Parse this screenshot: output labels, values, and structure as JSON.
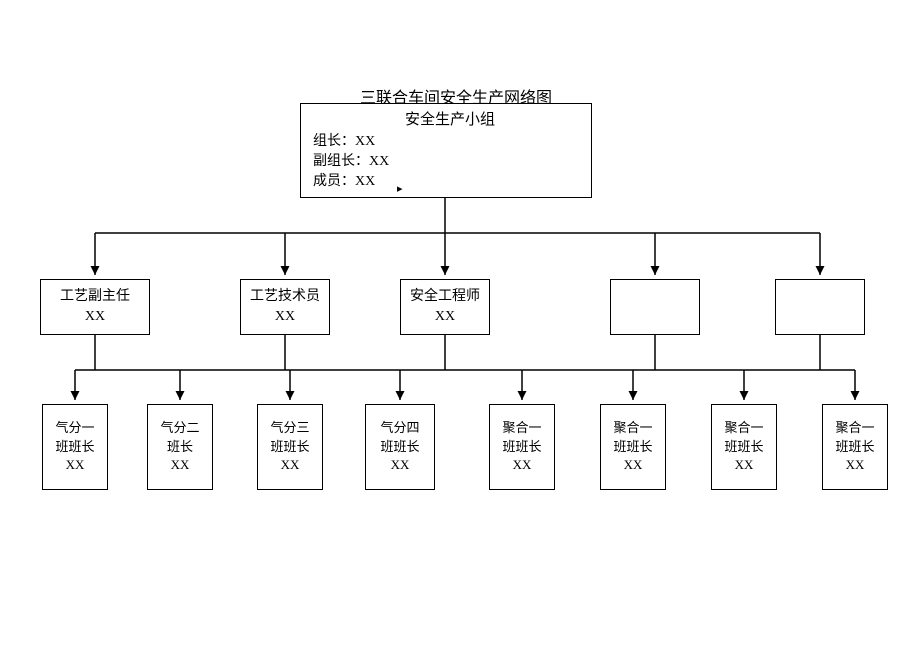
{
  "title": "三联合车间安全生产网络图",
  "top_box": {
    "title": "安全生产小组",
    "lines": [
      "组长：XX",
      "副组长：XX",
      "成员：XX"
    ]
  },
  "mid": [
    {
      "role": "工艺副主任",
      "name": "XX"
    },
    {
      "role": "工艺技术员",
      "name": "XX"
    },
    {
      "role": "安全工程师",
      "name": "XX"
    },
    {
      "role": "",
      "name": ""
    },
    {
      "role": "",
      "name": ""
    }
  ],
  "bottom": [
    {
      "l1": "气分一",
      "l2": "班班长",
      "name": "XX"
    },
    {
      "l1": "气分二",
      "l2": "班长",
      "name": "XX"
    },
    {
      "l1": "气分三",
      "l2": "班班长",
      "name": "XX"
    },
    {
      "l1": "气分四",
      "l2": "班班长",
      "name": "XX"
    },
    {
      "l1": "聚合一",
      "l2": "班班长",
      "name": "XX"
    },
    {
      "l1": "聚合一",
      "l2": "班班长",
      "name": "XX"
    },
    {
      "l1": "聚合一",
      "l2": "班班长",
      "name": "XX"
    },
    {
      "l1": "聚合一",
      "l2": "班班长",
      "name": "XX"
    }
  ],
  "chart_data": {
    "type": "tree",
    "title": "三联合车间安全生产网络图",
    "root": {
      "label": "安全生产小组 (组长：XX / 副组长：XX / 成员：XX)",
      "children_level2": [
        "工艺副主任 XX",
        "工艺技术员 XX",
        "安全工程师 XX",
        "(空)",
        "(空)"
      ],
      "children_level3": [
        "气分一班班长 XX",
        "气分二班长 XX",
        "气分三班班长 XX",
        "气分四班班长 XX",
        "聚合一班班长 XX",
        "聚合一班班长 XX",
        "聚合一班班长 XX",
        "聚合一班班长 XX"
      ]
    }
  }
}
